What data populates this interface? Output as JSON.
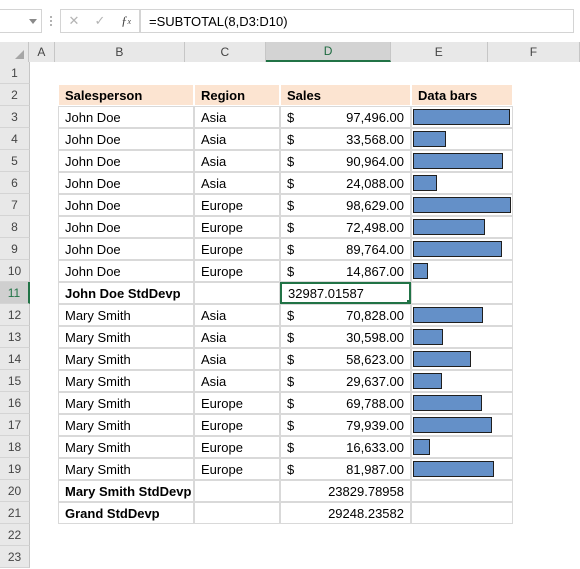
{
  "formula_bar": {
    "name_box_value": "",
    "cancel_icon": "close-icon",
    "confirm_icon": "check-icon",
    "function_icon": "fx-icon",
    "formula": "=SUBTOTAL(8,D3:D10)"
  },
  "grid": {
    "columns": [
      "A",
      "B",
      "C",
      "D",
      "E",
      "F"
    ],
    "active_column": "D",
    "active_row": "11",
    "row_numbers": [
      "1",
      "2",
      "3",
      "4",
      "5",
      "6",
      "7",
      "8",
      "9",
      "10",
      "11",
      "12",
      "13",
      "14",
      "15",
      "16",
      "17",
      "18",
      "19",
      "20",
      "21",
      "22",
      "23"
    ]
  },
  "table": {
    "headers": [
      "Salesperson",
      "Region",
      "Sales",
      "Data bars"
    ],
    "rows": [
      {
        "row": "3",
        "salesperson": "John Doe",
        "region": "Asia",
        "currency": "$",
        "sales": "97,496.00",
        "value": 97496,
        "bar": true
      },
      {
        "row": "4",
        "salesperson": "John Doe",
        "region": "Asia",
        "currency": "$",
        "sales": "33,568.00",
        "value": 33568,
        "bar": true
      },
      {
        "row": "5",
        "salesperson": "John Doe",
        "region": "Asia",
        "currency": "$",
        "sales": "90,964.00",
        "value": 90964,
        "bar": true
      },
      {
        "row": "6",
        "salesperson": "John Doe",
        "region": "Asia",
        "currency": "$",
        "sales": "24,088.00",
        "value": 24088,
        "bar": true
      },
      {
        "row": "7",
        "salesperson": "John Doe",
        "region": "Europe",
        "currency": "$",
        "sales": "98,629.00",
        "value": 98629,
        "bar": true
      },
      {
        "row": "8",
        "salesperson": "John Doe",
        "region": "Europe",
        "currency": "$",
        "sales": "72,498.00",
        "value": 72498,
        "bar": true
      },
      {
        "row": "9",
        "salesperson": "John Doe",
        "region": "Europe",
        "currency": "$",
        "sales": "89,764.00",
        "value": 89764,
        "bar": true
      },
      {
        "row": "10",
        "salesperson": "John Doe",
        "region": "Europe",
        "currency": "$",
        "sales": "14,867.00",
        "value": 14867,
        "bar": true
      },
      {
        "row": "12",
        "salesperson": "Mary Smith",
        "region": "Asia",
        "currency": "$",
        "sales": "70,828.00",
        "value": 70828,
        "bar": true
      },
      {
        "row": "13",
        "salesperson": "Mary Smith",
        "region": "Asia",
        "currency": "$",
        "sales": "30,598.00",
        "value": 30598,
        "bar": true
      },
      {
        "row": "14",
        "salesperson": "Mary Smith",
        "region": "Asia",
        "currency": "$",
        "sales": "58,623.00",
        "value": 58623,
        "bar": true
      },
      {
        "row": "15",
        "salesperson": "Mary Smith",
        "region": "Asia",
        "currency": "$",
        "sales": "29,637.00",
        "value": 29637,
        "bar": true
      },
      {
        "row": "16",
        "salesperson": "Mary Smith",
        "region": "Europe",
        "currency": "$",
        "sales": "69,788.00",
        "value": 69788,
        "bar": true
      },
      {
        "row": "17",
        "salesperson": "Mary Smith",
        "region": "Europe",
        "currency": "$",
        "sales": "79,939.00",
        "value": 79939,
        "bar": true
      },
      {
        "row": "18",
        "salesperson": "Mary Smith",
        "region": "Europe",
        "currency": "$",
        "sales": "16,633.00",
        "value": 16633,
        "bar": true
      },
      {
        "row": "19",
        "salesperson": "Mary Smith",
        "region": "Europe",
        "currency": "$",
        "sales": "81,987.00",
        "value": 81987,
        "bar": true
      }
    ],
    "subtotals": [
      {
        "row": "11",
        "label": "John Doe StdDevp",
        "value": "32987.01587",
        "selected": true
      },
      {
        "row": "20",
        "label": "Mary Smith StdDevp",
        "value": "23829.78958",
        "selected": false
      },
      {
        "row": "21",
        "label": "Grand StdDevp",
        "value": "29248.23582",
        "selected": false
      }
    ]
  },
  "colors": {
    "header_fill": "#fce4d1",
    "databar_fill": "#6490c8",
    "databar_border": "#1f1f1f",
    "selection_green": "#217346"
  }
}
